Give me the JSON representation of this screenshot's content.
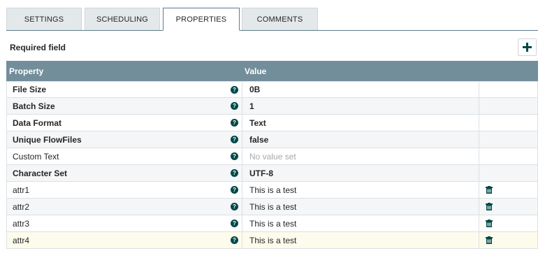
{
  "tabs": [
    {
      "label": "SETTINGS",
      "active": false
    },
    {
      "label": "SCHEDULING",
      "active": false
    },
    {
      "label": "PROPERTIES",
      "active": true
    },
    {
      "label": "COMMENTS",
      "active": false
    }
  ],
  "required_label": "Required field",
  "add_icon": "plus-icon",
  "table": {
    "headers": {
      "property": "Property",
      "value": "Value"
    },
    "rows": [
      {
        "name": "File Size",
        "required": true,
        "value": "0B",
        "value_set": true,
        "deletable": false
      },
      {
        "name": "Batch Size",
        "required": true,
        "value": "1",
        "value_set": true,
        "deletable": false
      },
      {
        "name": "Data Format",
        "required": true,
        "value": "Text",
        "value_set": true,
        "deletable": false
      },
      {
        "name": "Unique FlowFiles",
        "required": true,
        "value": "false",
        "value_set": true,
        "deletable": false
      },
      {
        "name": "Custom Text",
        "required": false,
        "value": "No value set",
        "value_set": false,
        "deletable": false
      },
      {
        "name": "Character Set",
        "required": true,
        "value": "UTF-8",
        "value_set": true,
        "deletable": false
      },
      {
        "name": "attr1",
        "required": false,
        "value": "This is a test",
        "value_set": true,
        "deletable": true
      },
      {
        "name": "attr2",
        "required": false,
        "value": "This is a test",
        "value_set": true,
        "deletable": true
      },
      {
        "name": "attr3",
        "required": false,
        "value": "This is a test",
        "value_set": true,
        "deletable": true
      },
      {
        "name": "attr4",
        "required": false,
        "value": "This is a test",
        "value_set": true,
        "deletable": true,
        "selected": true
      }
    ]
  },
  "icons": {
    "help": "help-circle-icon",
    "delete": "trash-icon"
  },
  "colors": {
    "header": "#728e9b",
    "accent": "#004849",
    "selected_row": "#fdfbec"
  }
}
